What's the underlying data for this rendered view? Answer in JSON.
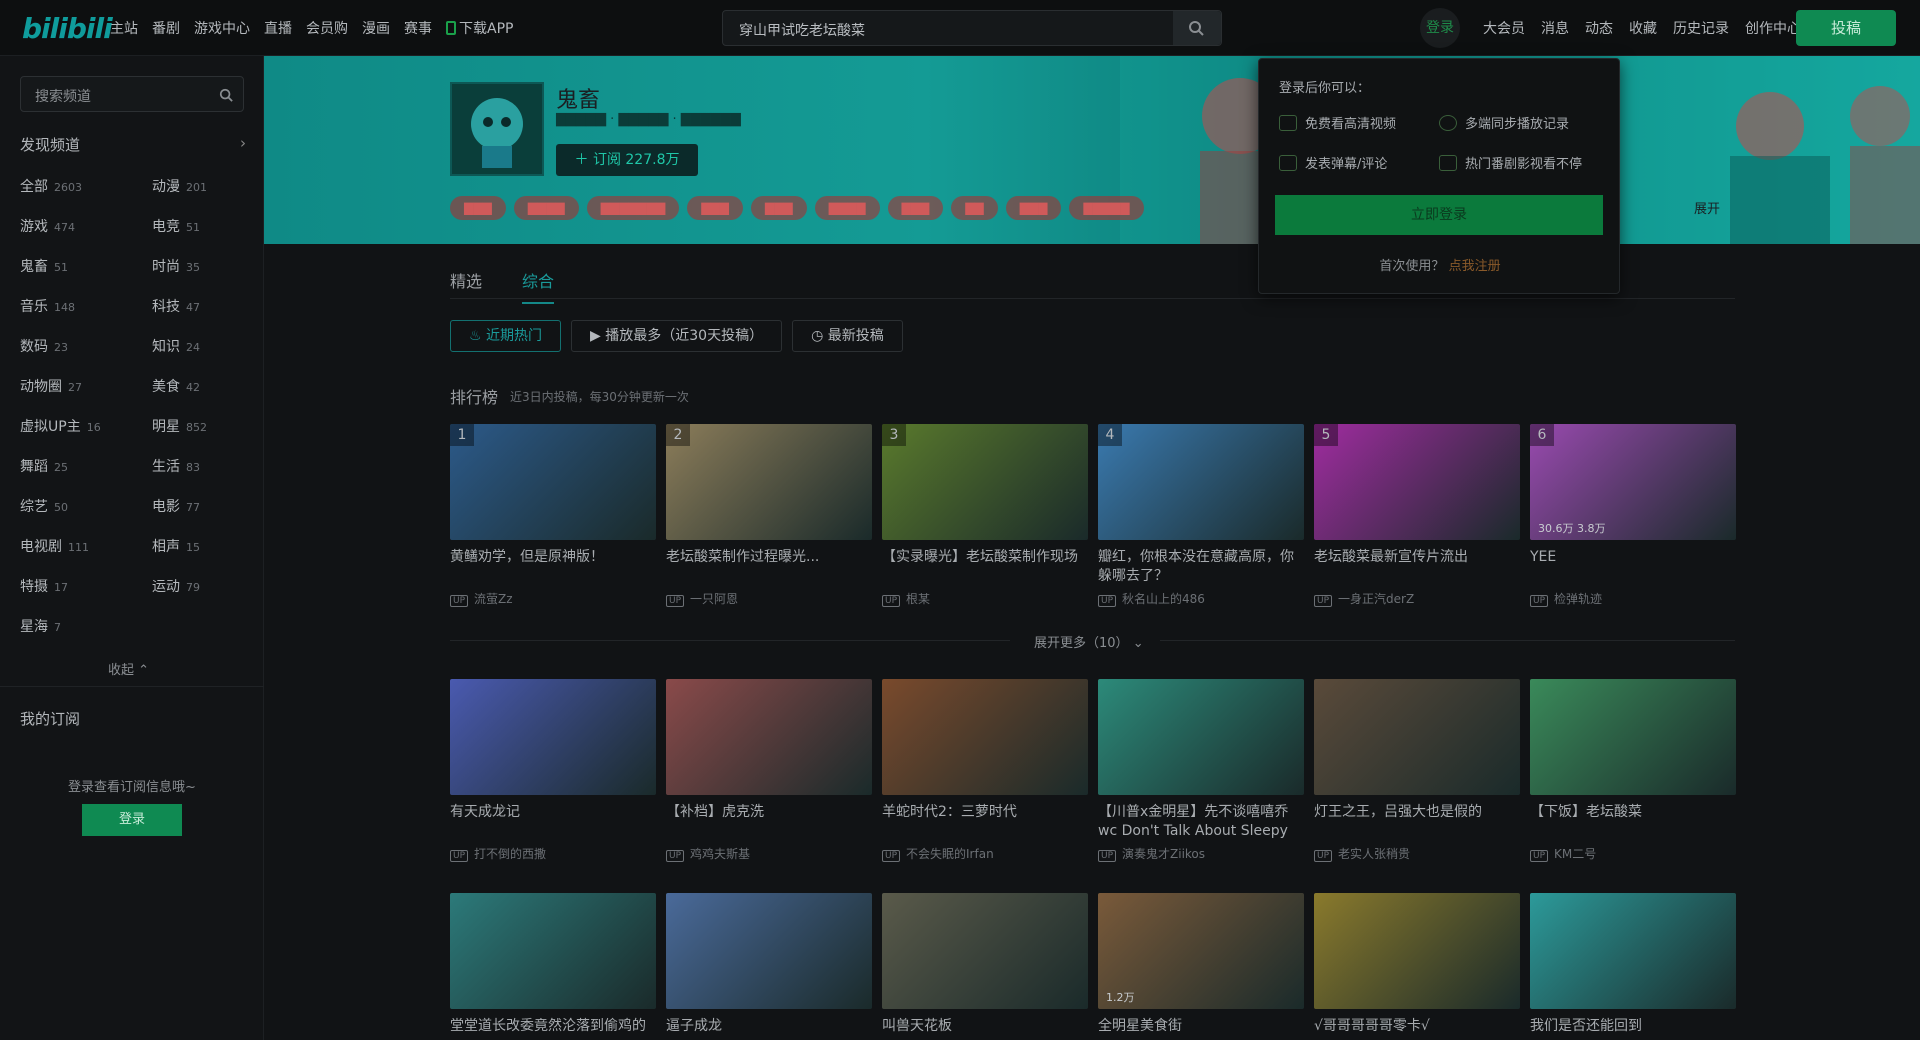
{
  "header": {
    "logo": "bilibili",
    "nav": [
      "主站",
      "番剧",
      "游戏中心",
      "直播",
      "会员购",
      "漫画",
      "赛事",
      "下载APP"
    ],
    "search_value": "穿山甲试吃老坛酸菜",
    "login_label": "登录",
    "right_nav": [
      "大会员",
      "消息",
      "动态",
      "收藏",
      "历史记录",
      "创作中心"
    ],
    "upload_label": "投稿"
  },
  "sidebar": {
    "search_placeholder": "搜索频道",
    "discover_label": "发现频道",
    "channels": [
      {
        "name": "全部",
        "count": "2603"
      },
      {
        "name": "动漫",
        "count": "201"
      },
      {
        "name": "游戏",
        "count": "474"
      },
      {
        "name": "电竞",
        "count": "51"
      },
      {
        "name": "鬼畜",
        "count": "51"
      },
      {
        "name": "时尚",
        "count": "35"
      },
      {
        "name": "音乐",
        "count": "148"
      },
      {
        "name": "科技",
        "count": "47"
      },
      {
        "name": "数码",
        "count": "23"
      },
      {
        "name": "知识",
        "count": "24"
      },
      {
        "name": "动物圈",
        "count": "27"
      },
      {
        "name": "美食",
        "count": "42"
      },
      {
        "name": "虚拟UP主",
        "count": "16"
      },
      {
        "name": "明星",
        "count": "852"
      },
      {
        "name": "舞蹈",
        "count": "25"
      },
      {
        "name": "生活",
        "count": "83"
      },
      {
        "name": "综艺",
        "count": "50"
      },
      {
        "name": "电影",
        "count": "77"
      },
      {
        "name": "电视剧",
        "count": "111"
      },
      {
        "name": "相声",
        "count": "15"
      },
      {
        "name": "特摄",
        "count": "17"
      },
      {
        "name": "运动",
        "count": "79"
      },
      {
        "name": "星海",
        "count": "7"
      }
    ],
    "collapse_label": "收起",
    "my_sub_label": "我的订阅",
    "sub_tip": "登录查看订阅信息哦~",
    "login_label": "登录"
  },
  "banner": {
    "channel_name": "鬼畜",
    "subscribe_label": "订阅 227.8万",
    "expand_label": "展开"
  },
  "popup": {
    "title": "登录后你可以：",
    "perks": [
      "免费看高清视频",
      "多端同步播放记录",
      "发表弹幕/评论",
      "热门番剧影视看不停"
    ],
    "login_label": "立即登录",
    "first_use": "首次使用？",
    "register": "点我注册"
  },
  "tabs": [
    "精选",
    "综合"
  ],
  "filters": [
    "近期热门",
    "播放最多（近30天投稿）",
    "最新投稿"
  ],
  "ranking": {
    "title": "排行榜",
    "subtitle": "近3日内投稿，每30分钟更新一次"
  },
  "more_label": "展开更多（10）",
  "row1": [
    {
      "num": "1",
      "title": "黄鳝劝学，但是原神版！",
      "up": "流萤Zz",
      "stats": "",
      "color": "#2c5a8a"
    },
    {
      "num": "2",
      "title": "老坛酸菜制作过程曝光...",
      "up": "一只阿恩",
      "stats": "",
      "color": "#8c7d5a"
    },
    {
      "num": "3",
      "title": "【实录曝光】老坛酸菜制作现场",
      "up": "根某",
      "stats": "",
      "color": "#5a7a2c"
    },
    {
      "num": "4",
      "title": "瓣红，你根本没在意藏高原，你躲哪去了？",
      "up": "秋名山上的486",
      "stats": "",
      "color": "#3a7ab0"
    },
    {
      "num": "5",
      "title": "老坛酸菜最新宣传片流出",
      "up": "一身正汽derZ",
      "stats": "",
      "color": "#a02ca0"
    },
    {
      "num": "6",
      "title": "YEE",
      "up": "检弹轨迹",
      "stats": "30.6万   3.8万",
      "color": "#9a4ab0"
    }
  ],
  "row2": [
    {
      "title": "有天成龙记",
      "up": "打不倒的西撒",
      "stats": "",
      "color": "#4a5ab0"
    },
    {
      "title": "【补档】虎克洗",
      "up": "鸡鸡夫斯基",
      "stats": "",
      "color": "#8a4a4a"
    },
    {
      "title": "羊蛇时代2：三萝时代",
      "up": "不会失眠的Irfan",
      "stats": "",
      "color": "#7a4a2c"
    },
    {
      "title": "【川普x金明星】先不谈嘻嘻乔wc Don't Talk About Sleepy Joe...",
      "up": "演奏鬼才Ziikos",
      "stats": "",
      "color": "#2c8a7a"
    },
    {
      "title": "灯王之王，吕强大也是假的",
      "up": "老实人张稍贵",
      "stats": "",
      "color": "#5a4a3a"
    },
    {
      "title": "【下饭】老坛酸菜",
      "up": "KM二号",
      "stats": "",
      "color": "#3a8a5a"
    }
  ],
  "row3": [
    {
      "title": "堂堂道长改委竟然沦落到偷鸡的",
      "up": "",
      "stats": "",
      "color": "#2c7a7a"
    },
    {
      "title": "逼子成龙",
      "up": "",
      "stats": "",
      "color": "#4a6a9a"
    },
    {
      "title": "叫兽天花板",
      "up": "",
      "stats": "",
      "color": "#5a5a4a"
    },
    {
      "title": "全明星美食街",
      "up": "",
      "stats": "1.2万",
      "color": "#7a5a3a"
    },
    {
      "title": "√哥哥哥哥哥零卡√",
      "up": "",
      "stats": "",
      "color": "#8a7a2c"
    },
    {
      "title": "我们是否还能回到",
      "up": "",
      "stats": "",
      "color": "#2c9a9a"
    }
  ]
}
